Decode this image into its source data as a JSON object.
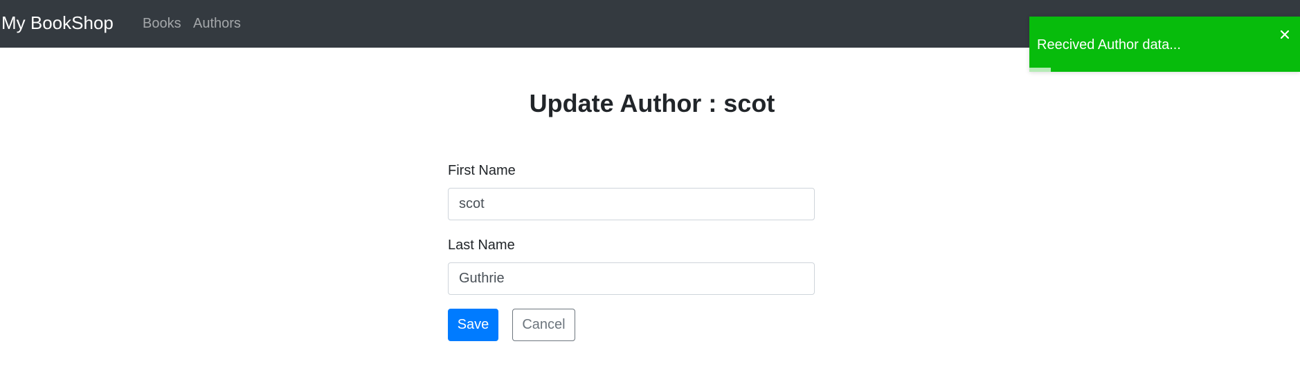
{
  "navbar": {
    "brand": "My BookShop",
    "links": [
      {
        "label": "Books"
      },
      {
        "label": "Authors"
      }
    ]
  },
  "page": {
    "title": "Update Author : scot"
  },
  "form": {
    "first_name": {
      "label": "First Name",
      "value": "scot"
    },
    "last_name": {
      "label": "Last Name",
      "value": "Guthrie"
    },
    "save_label": "Save",
    "cancel_label": "Cancel"
  },
  "toast": {
    "message": "Reecived Author data...",
    "close_icon": "close-icon",
    "progress_remaining": 0.08,
    "color": "#07bc0c"
  },
  "colors": {
    "navbar": "#343a40",
    "primary": "#007bff",
    "secondary": "#6c757d",
    "success": "#07bc0c"
  }
}
